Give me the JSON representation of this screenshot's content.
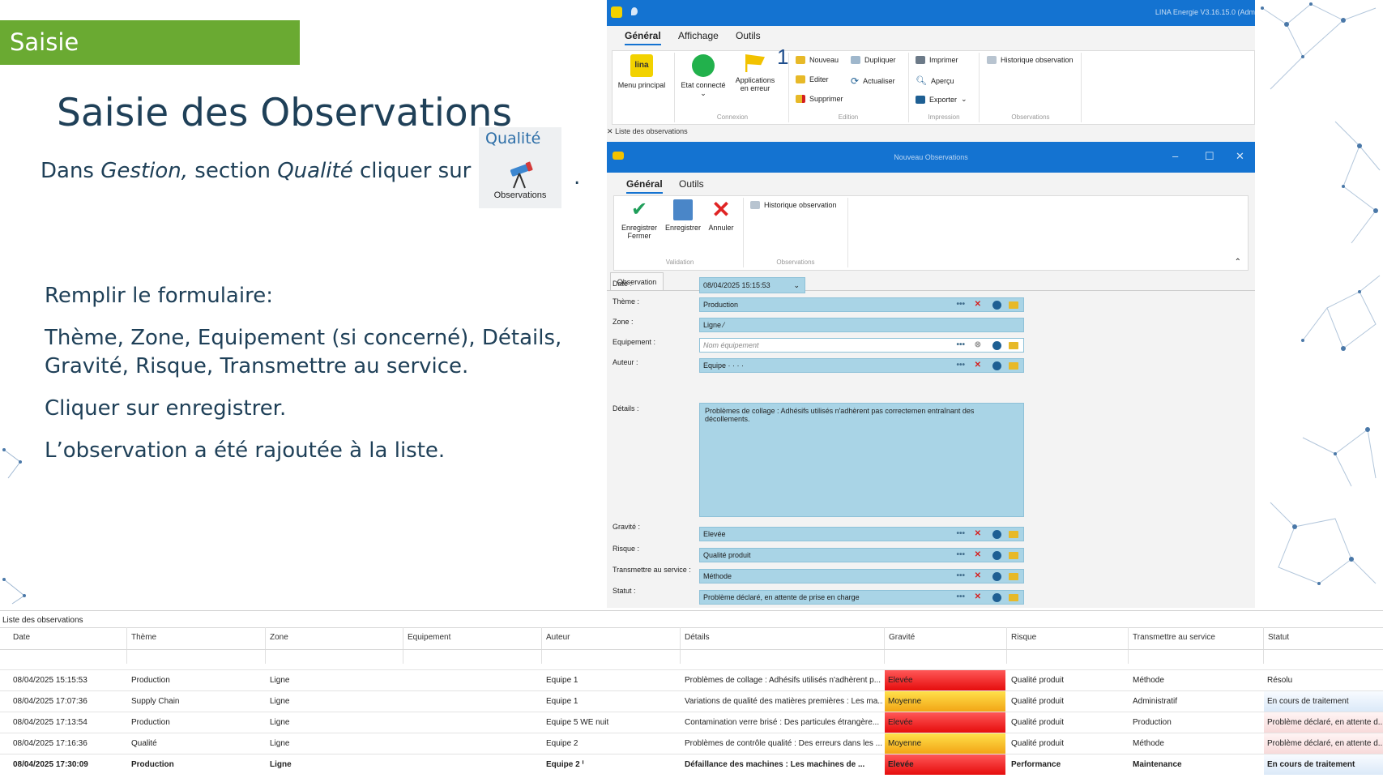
{
  "slide": {
    "tag": "Saisie",
    "title": "Saisie des Observations",
    "intro_prefix": "Dans ",
    "intro_gestion": "Gestion,",
    "intro_middle": " section ",
    "intro_qualite": "Qualité",
    "intro_suffix": " cliquer sur",
    "intro_dot": ".",
    "qualite_card": {
      "category": "Qualité",
      "label": "Observations"
    },
    "bullets": [
      "Remplir le formulaire:",
      "Thème, Zone, Equipement (si concerné), Détails, Gravité, Risque, Transmettre au service.",
      "Cliquer sur enregistrer.",
      "L’observation a été rajoutée à la liste."
    ]
  },
  "app": {
    "title_right": "LINA Energie  V3.16.15.0  (Adm",
    "tabs": [
      "Général",
      "Affichage",
      "Outils"
    ],
    "ribbon": {
      "menu_principal": "Menu principal",
      "etat_connecte": "Etat connecté",
      "applications": "Applications en erreur",
      "badge": "1",
      "nouveau": "Nouveau",
      "dupliquer": "Dupliquer",
      "editer": "Editer",
      "actualiser": "Actualiser",
      "supprimer": "Supprimer",
      "imprimer": "Imprimer",
      "apercu": "Aperçu",
      "exporter": "Exporter",
      "historique": "Historique observation",
      "groups": [
        "Connexion",
        "Edition",
        "Impression",
        "Observations"
      ]
    },
    "list_label": "Liste des observations"
  },
  "dialog": {
    "title": "Nouveau Observations",
    "tabs": [
      "Général",
      "Outils"
    ],
    "ribbon": {
      "enregistrer_fermer": "Enregistrer Fermer",
      "enregistrer": "Enregistrer",
      "annuler": "Annuler",
      "historique": "Historique observation",
      "groups": [
        "Validation",
        "Observations"
      ]
    },
    "form_tab": "Observation",
    "fields": {
      "date_label": "Date :",
      "date": "08/04/2025 15:15:53",
      "theme_label": "Thème :",
      "theme": "Production",
      "zone_label": "Zone :",
      "zone": "Ligne ⁄",
      "equipement_label": "Equipement :",
      "equipement_placeholder": "Nom équipement",
      "auteur_label": "Auteur :",
      "auteur": "Equipe ·  ·  ·   ·",
      "details_label": "Détails :",
      "details": "Problèmes de collage : Adhésifs utilisés n'adhèrent pas correctemen entraînant des décollements.",
      "gravite_label": "Gravité :",
      "gravite": "Elevée",
      "risque_label": "Risque :",
      "risque": "Qualité produit",
      "transmettre_label": "Transmettre au service :",
      "transmettre": "Méthode",
      "statut_label": "Statut :",
      "statut": "Problème déclaré, en attente de prise en charge"
    }
  },
  "grid": {
    "caption": "Liste des observations",
    "columns": [
      "Date",
      "Thème",
      "Zone",
      "Equipement",
      "Auteur",
      "Détails",
      "Gravité",
      "Risque",
      "Transmettre au service",
      "Statut"
    ],
    "rows": [
      [
        "08/04/2025 15:15:53",
        "Production",
        "Ligne",
        "",
        "Equipe 1",
        "Problèmes de collage : Adhésifs utilisés n'adhèrent p...",
        "Elevée",
        "Qualité produit",
        "Méthode",
        "Résolu"
      ],
      [
        "08/04/2025 17:07:36",
        "Supply Chain",
        "Ligne",
        "",
        "Equipe 1",
        "Variations de qualité des matières premières : Les ma...",
        "Moyenne",
        "Qualité produit",
        "Administratif",
        "En cours de traitement"
      ],
      [
        "08/04/2025 17:13:54",
        "Production",
        "Ligne",
        "",
        "Equipe 5 WE nuit",
        "Contamination verre brisé : Des particules étrangère...",
        "Elevée",
        "Qualité produit",
        "Production",
        "Problème déclaré, en attente d..."
      ],
      [
        "08/04/2025 17:16:36",
        "Qualité",
        "Ligne",
        "",
        "Equipe 2",
        "Problèmes de contrôle qualité : Des erreurs dans les ...",
        "Moyenne",
        "Qualité produit",
        "Méthode",
        "Problème déclaré, en attente d..."
      ],
      [
        "08/04/2025 17:30:09",
        "Production",
        "Ligne",
        "",
        "Equipe 2 ᑊ",
        "Défaillance des machines : Les machines de ...",
        "Elevée",
        "Performance",
        "Maintenance",
        "En cours de traitement"
      ]
    ]
  },
  "colors": {
    "green_tag": "#6aaa32",
    "title_blue": "#1f4058",
    "win_blue": "#1473d1",
    "field_blue": "#a9d4e6"
  }
}
